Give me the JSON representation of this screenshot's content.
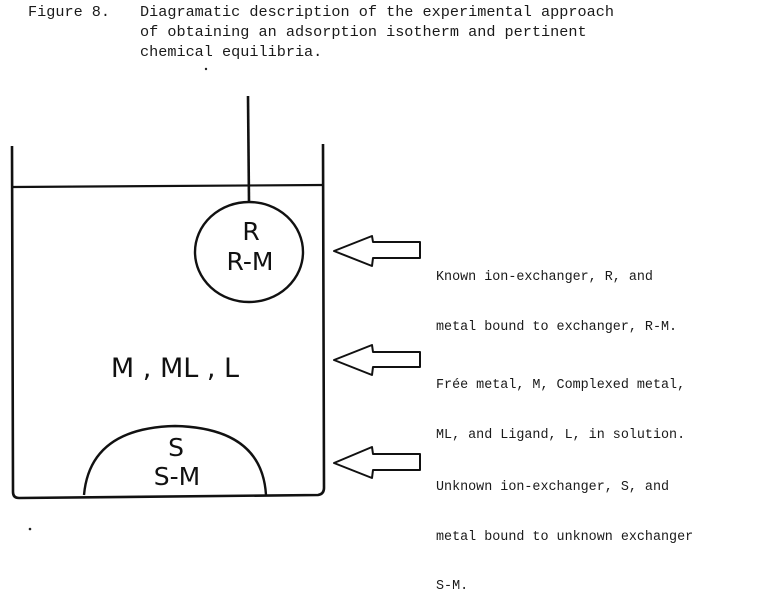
{
  "caption": {
    "figure_label": "Figure 8.",
    "lines": [
      "Diagramatic description of the experimental approach",
      "of obtaining an adsorption isotherm and pertinent",
      "chemical equilibria."
    ]
  },
  "diagram": {
    "suspended_exchanger": {
      "line1": "R",
      "line2": "R-M"
    },
    "solution": {
      "label": "M , ML , L"
    },
    "bottom_exchanger": {
      "line1": "S",
      "line2": "S-M"
    },
    "annotations": [
      {
        "lines": [
          "Known ion-exchanger, R, and",
          "metal bound to exchanger, R-M."
        ]
      },
      {
        "lines": [
          "Frée metal, M, Complexed metal,",
          "ML, and Ligand, L, in solution."
        ]
      },
      {
        "lines": [
          "Unknown ion-exchanger, S, and",
          "metal bound to unknown exchanger",
          "S-M."
        ]
      }
    ]
  },
  "colors": {
    "ink": "#111111",
    "paper": "#ffffff"
  }
}
